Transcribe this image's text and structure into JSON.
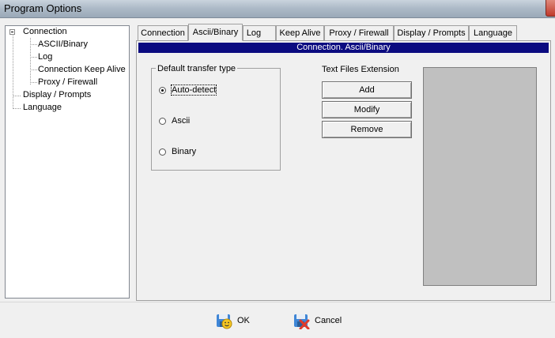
{
  "window": {
    "title": "Program Options"
  },
  "tree": {
    "items": [
      {
        "label": "Connection"
      },
      {
        "label": "ASCII/Binary"
      },
      {
        "label": "Log"
      },
      {
        "label": "Connection Keep Alive"
      },
      {
        "label": "Proxy / Firewall"
      },
      {
        "label": "Display / Prompts"
      },
      {
        "label": "Language"
      }
    ]
  },
  "tabs": [
    {
      "label": "Connection"
    },
    {
      "label": "Ascii/Binary",
      "active": true
    },
    {
      "label": "Log"
    },
    {
      "label": "Keep Alive"
    },
    {
      "label": "Proxy / Firewall"
    },
    {
      "label": "Display / Prompts"
    },
    {
      "label": "Language"
    }
  ],
  "section": {
    "header": "Connection. Ascii/Binary"
  },
  "transfer": {
    "legend": "Default transfer type",
    "options": [
      {
        "label": "Auto-detect",
        "selected": true
      },
      {
        "label": "Ascii",
        "selected": false
      },
      {
        "label": "Binary",
        "selected": false
      }
    ]
  },
  "extensions": {
    "caption": "Text Files Extension",
    "add_label": "Add",
    "modify_label": "Modify",
    "remove_label": "Remove"
  },
  "footer": {
    "ok_label": "OK",
    "cancel_label": "Cancel"
  }
}
